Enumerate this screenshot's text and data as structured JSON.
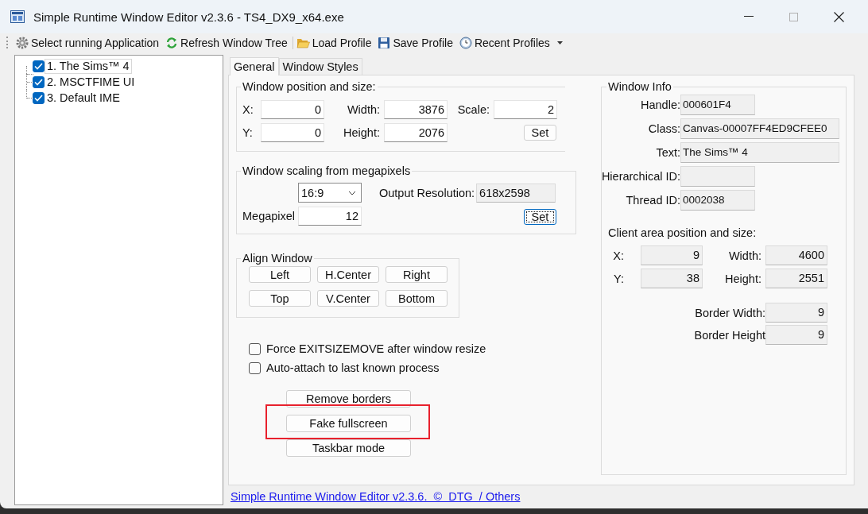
{
  "window": {
    "title": "Simple Runtime Window Editor v2.3.6 - TS4_DX9_x64.exe"
  },
  "toolbar": [
    {
      "label": "Select running Application",
      "kind": "gear",
      "separator_before": false,
      "dropdown": false
    },
    {
      "label": "Refresh Window Tree",
      "kind": "refresh",
      "separator_before": false,
      "dropdown": false
    },
    {
      "label": "Load Profile",
      "kind": "folder",
      "separator_before": true,
      "dropdown": false
    },
    {
      "label": "Save Profile",
      "kind": "disk",
      "separator_before": false,
      "dropdown": false
    },
    {
      "label": "Recent Profiles",
      "kind": "clock",
      "separator_before": false,
      "dropdown": true
    }
  ],
  "tree": [
    {
      "label": "1. The Sims™ 4",
      "checked": true,
      "selected": true
    },
    {
      "label": "2. MSCTFIME UI",
      "checked": true,
      "selected": false
    },
    {
      "label": "3. Default IME",
      "checked": true,
      "selected": false
    }
  ],
  "tabs": [
    {
      "label": "General",
      "selected": true
    },
    {
      "label": "Window Styles",
      "selected": false
    }
  ],
  "position_group": {
    "title": "Window position and size:",
    "rows": [
      [
        {
          "label": "X:",
          "value": "0"
        },
        {
          "label": "Width:",
          "value": "3876"
        },
        {
          "label": "Scale:",
          "value": "2"
        }
      ],
      [
        {
          "label": "Y:",
          "value": "0"
        },
        {
          "label": "Height:",
          "value": "2076"
        }
      ]
    ],
    "set_button": "Set"
  },
  "scaling_group": {
    "title": "Window scaling from megapixels",
    "aspect": "16:9",
    "output_label": "Output Resolution:",
    "output_value": "618x2598",
    "megapixels_label": "Megapixel",
    "megapixels_value": "12",
    "set_button": {
      "label": "Set",
      "focused": true
    }
  },
  "align_group": {
    "title": "Align Window",
    "buttons": [
      "Left",
      "H.Center",
      "Right",
      "Top",
      "V.Center",
      "Bottom"
    ]
  },
  "options": [
    {
      "label": "Force EXITSIZEMOVE after window resize",
      "checked": false
    },
    {
      "label": "Auto-attach to last known process",
      "checked": false
    }
  ],
  "actions": [
    {
      "label": "Remove borders",
      "highlighted": false
    },
    {
      "label": "Fake fullscreen",
      "highlighted": true
    },
    {
      "label": "Taskbar mode",
      "highlighted": false
    }
  ],
  "window_info": {
    "title": "Window Info",
    "fields": [
      {
        "label": "Handle:",
        "value": "000601F4",
        "kind": "short"
      },
      {
        "label": "Class:",
        "value": "Canvas-00007FF4ED9CFEE0",
        "kind": "long"
      },
      {
        "label": "Text:",
        "value": "The Sims™ 4",
        "kind": "long"
      },
      {
        "label": "Hierarchical ID:",
        "kind": "short"
      },
      {
        "label": "Thread ID:",
        "value": "0002038",
        "kind": "short"
      }
    ],
    "client_title": "Client area position and size:",
    "client_rows": [
      [
        {
          "label": "X:",
          "value": "9"
        },
        {
          "label": "Width:",
          "value": "4600"
        }
      ],
      [
        {
          "label": "Y:",
          "value": "38"
        },
        {
          "label": "Height:",
          "value": "2551"
        }
      ]
    ],
    "border_fields": [
      {
        "label": "Border Width:",
        "value": "9"
      },
      {
        "label": "Border Height",
        "value": "9"
      }
    ]
  },
  "footer_link": "Simple Runtime Window Editor v2.3.6.  ©  DTG  / Others"
}
